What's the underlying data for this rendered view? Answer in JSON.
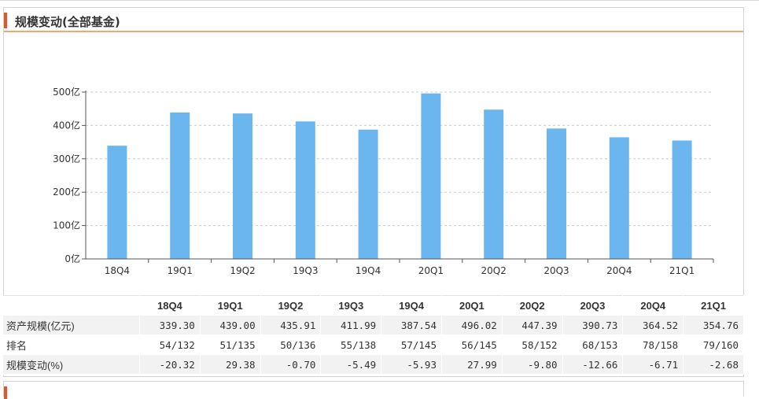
{
  "panel": {
    "title": "规模变动(全部基金)"
  },
  "colors": {
    "bar": "#6cb6ef",
    "accent": "#e2562a",
    "header_line": "#f3a76c"
  },
  "chart_data": {
    "type": "bar",
    "categories": [
      "18Q4",
      "19Q1",
      "19Q2",
      "19Q3",
      "19Q4",
      "20Q1",
      "20Q2",
      "20Q3",
      "20Q4",
      "21Q1"
    ],
    "values": [
      339.3,
      439.0,
      435.91,
      411.99,
      387.54,
      496.02,
      447.39,
      390.73,
      364.52,
      354.76
    ],
    "ylim": [
      0,
      500
    ],
    "yticks": [
      "0亿",
      "100亿",
      "200亿",
      "300亿",
      "400亿",
      "500亿"
    ],
    "grid": true
  },
  "table": {
    "columns": [
      "18Q4",
      "19Q1",
      "19Q2",
      "19Q3",
      "19Q4",
      "20Q1",
      "20Q2",
      "20Q3",
      "20Q4",
      "21Q1"
    ],
    "rows": [
      {
        "label": "资产规模(亿元)",
        "cells": [
          "339.30",
          "439.00",
          "435.91",
          "411.99",
          "387.54",
          "496.02",
          "447.39",
          "390.73",
          "364.52",
          "354.76"
        ]
      },
      {
        "label": "排名",
        "cells": [
          "54/132",
          "51/135",
          "50/136",
          "55/138",
          "57/145",
          "56/145",
          "58/152",
          "68/153",
          "78/158",
          "79/160"
        ]
      },
      {
        "label": "规模变动(%)",
        "cells": [
          "-20.32",
          "29.38",
          "-0.70",
          "-5.49",
          "-5.93",
          "27.99",
          "-9.80",
          "-12.66",
          "-6.71",
          "-2.68"
        ]
      }
    ]
  }
}
